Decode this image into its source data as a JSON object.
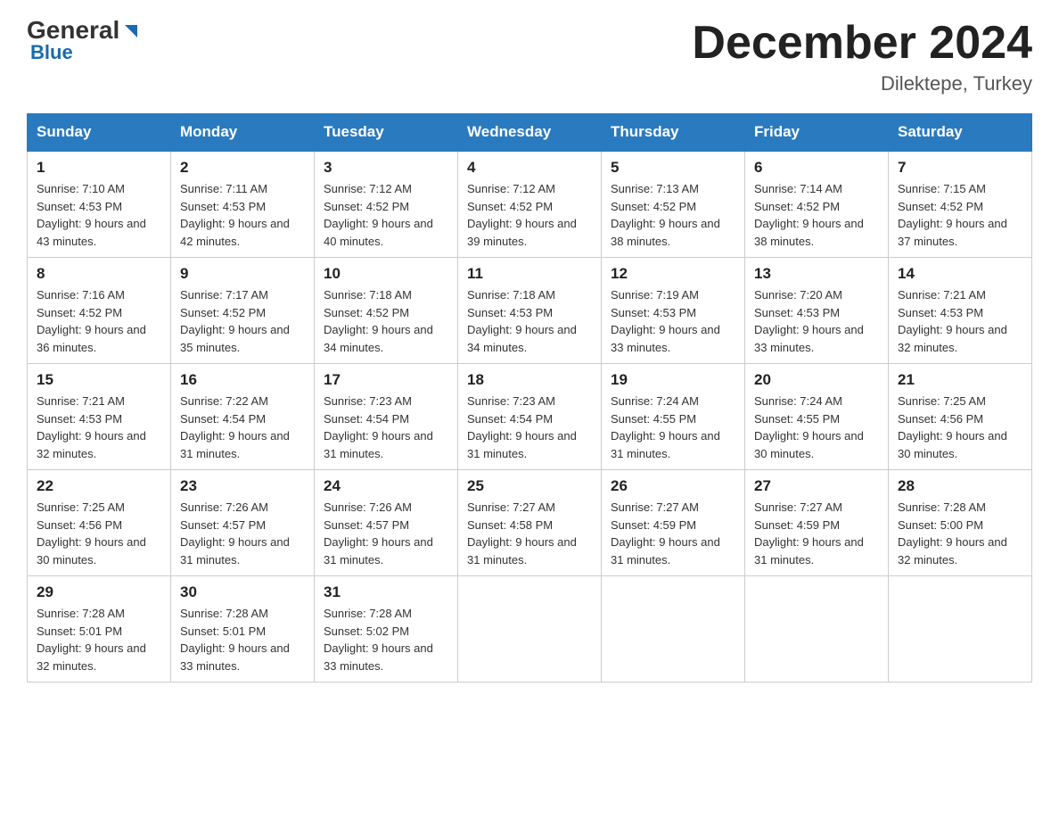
{
  "logo": {
    "general": "General",
    "blue": "Blue"
  },
  "header": {
    "month": "December 2024",
    "location": "Dilektepe, Turkey"
  },
  "days_of_week": [
    "Sunday",
    "Monday",
    "Tuesday",
    "Wednesday",
    "Thursday",
    "Friday",
    "Saturday"
  ],
  "weeks": [
    [
      {
        "date": "1",
        "sunrise": "7:10 AM",
        "sunset": "4:53 PM",
        "daylight": "9 hours and 43 minutes."
      },
      {
        "date": "2",
        "sunrise": "7:11 AM",
        "sunset": "4:53 PM",
        "daylight": "9 hours and 42 minutes."
      },
      {
        "date": "3",
        "sunrise": "7:12 AM",
        "sunset": "4:52 PM",
        "daylight": "9 hours and 40 minutes."
      },
      {
        "date": "4",
        "sunrise": "7:12 AM",
        "sunset": "4:52 PM",
        "daylight": "9 hours and 39 minutes."
      },
      {
        "date": "5",
        "sunrise": "7:13 AM",
        "sunset": "4:52 PM",
        "daylight": "9 hours and 38 minutes."
      },
      {
        "date": "6",
        "sunrise": "7:14 AM",
        "sunset": "4:52 PM",
        "daylight": "9 hours and 38 minutes."
      },
      {
        "date": "7",
        "sunrise": "7:15 AM",
        "sunset": "4:52 PM",
        "daylight": "9 hours and 37 minutes."
      }
    ],
    [
      {
        "date": "8",
        "sunrise": "7:16 AM",
        "sunset": "4:52 PM",
        "daylight": "9 hours and 36 minutes."
      },
      {
        "date": "9",
        "sunrise": "7:17 AM",
        "sunset": "4:52 PM",
        "daylight": "9 hours and 35 minutes."
      },
      {
        "date": "10",
        "sunrise": "7:18 AM",
        "sunset": "4:52 PM",
        "daylight": "9 hours and 34 minutes."
      },
      {
        "date": "11",
        "sunrise": "7:18 AM",
        "sunset": "4:53 PM",
        "daylight": "9 hours and 34 minutes."
      },
      {
        "date": "12",
        "sunrise": "7:19 AM",
        "sunset": "4:53 PM",
        "daylight": "9 hours and 33 minutes."
      },
      {
        "date": "13",
        "sunrise": "7:20 AM",
        "sunset": "4:53 PM",
        "daylight": "9 hours and 33 minutes."
      },
      {
        "date": "14",
        "sunrise": "7:21 AM",
        "sunset": "4:53 PM",
        "daylight": "9 hours and 32 minutes."
      }
    ],
    [
      {
        "date": "15",
        "sunrise": "7:21 AM",
        "sunset": "4:53 PM",
        "daylight": "9 hours and 32 minutes."
      },
      {
        "date": "16",
        "sunrise": "7:22 AM",
        "sunset": "4:54 PM",
        "daylight": "9 hours and 31 minutes."
      },
      {
        "date": "17",
        "sunrise": "7:23 AM",
        "sunset": "4:54 PM",
        "daylight": "9 hours and 31 minutes."
      },
      {
        "date": "18",
        "sunrise": "7:23 AM",
        "sunset": "4:54 PM",
        "daylight": "9 hours and 31 minutes."
      },
      {
        "date": "19",
        "sunrise": "7:24 AM",
        "sunset": "4:55 PM",
        "daylight": "9 hours and 31 minutes."
      },
      {
        "date": "20",
        "sunrise": "7:24 AM",
        "sunset": "4:55 PM",
        "daylight": "9 hours and 30 minutes."
      },
      {
        "date": "21",
        "sunrise": "7:25 AM",
        "sunset": "4:56 PM",
        "daylight": "9 hours and 30 minutes."
      }
    ],
    [
      {
        "date": "22",
        "sunrise": "7:25 AM",
        "sunset": "4:56 PM",
        "daylight": "9 hours and 30 minutes."
      },
      {
        "date": "23",
        "sunrise": "7:26 AM",
        "sunset": "4:57 PM",
        "daylight": "9 hours and 31 minutes."
      },
      {
        "date": "24",
        "sunrise": "7:26 AM",
        "sunset": "4:57 PM",
        "daylight": "9 hours and 31 minutes."
      },
      {
        "date": "25",
        "sunrise": "7:27 AM",
        "sunset": "4:58 PM",
        "daylight": "9 hours and 31 minutes."
      },
      {
        "date": "26",
        "sunrise": "7:27 AM",
        "sunset": "4:59 PM",
        "daylight": "9 hours and 31 minutes."
      },
      {
        "date": "27",
        "sunrise": "7:27 AM",
        "sunset": "4:59 PM",
        "daylight": "9 hours and 31 minutes."
      },
      {
        "date": "28",
        "sunrise": "7:28 AM",
        "sunset": "5:00 PM",
        "daylight": "9 hours and 32 minutes."
      }
    ],
    [
      {
        "date": "29",
        "sunrise": "7:28 AM",
        "sunset": "5:01 PM",
        "daylight": "9 hours and 32 minutes."
      },
      {
        "date": "30",
        "sunrise": "7:28 AM",
        "sunset": "5:01 PM",
        "daylight": "9 hours and 33 minutes."
      },
      {
        "date": "31",
        "sunrise": "7:28 AM",
        "sunset": "5:02 PM",
        "daylight": "9 hours and 33 minutes."
      },
      null,
      null,
      null,
      null
    ]
  ]
}
